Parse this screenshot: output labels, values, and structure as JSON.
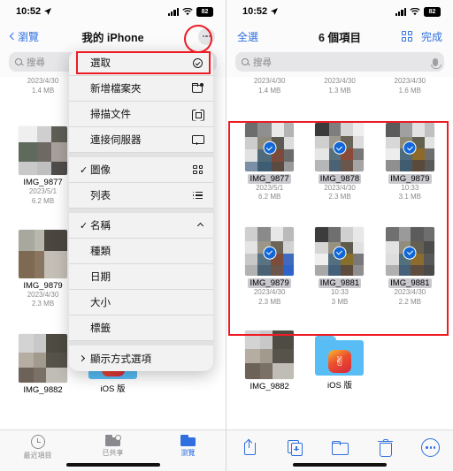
{
  "left": {
    "status": {
      "time": "10:52",
      "location_icon": "location-arrow",
      "signal_icon": "cellular-bars",
      "wifi_icon": "wifi",
      "battery": "82"
    },
    "nav": {
      "back_label": "瀏覽",
      "title": "我的 iPhone",
      "more_icon": "ellipsis-circle-icon"
    },
    "search": {
      "placeholder": "搜尋",
      "icon": "search-icon"
    },
    "menu": {
      "items": [
        {
          "label": "選取",
          "icon": "circle-check-icon",
          "checked": false,
          "highlighted": true
        },
        {
          "label": "新增檔案夾",
          "icon": "new-folder-icon",
          "checked": false
        },
        {
          "label": "掃描文件",
          "icon": "scan-document-icon",
          "checked": false
        },
        {
          "label": "連接伺服器",
          "icon": "server-icon",
          "checked": false
        },
        {
          "label": "圖像",
          "icon": "icon-view-icon",
          "checked": true
        },
        {
          "label": "列表",
          "icon": "list-view-icon",
          "checked": false
        },
        {
          "label": "名稱",
          "icon": "chevron-up-icon",
          "checked": true
        },
        {
          "label": "種類",
          "icon": "",
          "checked": false
        },
        {
          "label": "日期",
          "icon": "",
          "checked": false
        },
        {
          "label": "大小",
          "icon": "",
          "checked": false
        },
        {
          "label": "標籤",
          "icon": "",
          "checked": false
        },
        {
          "label": "顯示方式選項",
          "icon": "chevron-right-icon",
          "checked": false
        }
      ]
    },
    "files": [
      {
        "name": "",
        "date": "2023/4/30",
        "size": "1.4 MB",
        "type": "image",
        "partial": true
      },
      {
        "name": "IMG_9877",
        "date": "2023/5/1",
        "size": "6.2 MB",
        "type": "image"
      },
      {
        "name": "IMG_9879",
        "date": "2023/4/30",
        "size": "2.3 MB",
        "type": "image"
      },
      {
        "name": "IMG_9882",
        "date": "",
        "size": "",
        "type": "image"
      },
      {
        "name": "iOS 版",
        "date": "",
        "size": "",
        "type": "folder",
        "sub": ""
      }
    ],
    "tabs": [
      {
        "label": "最近項目",
        "icon": "clock-icon",
        "active": false
      },
      {
        "label": "已共享",
        "icon": "shared-folder-icon",
        "active": false
      },
      {
        "label": "瀏覽",
        "icon": "browse-folder-icon",
        "active": true
      }
    ]
  },
  "right": {
    "status": {
      "time": "10:52",
      "location_icon": "location-arrow",
      "signal_icon": "cellular-bars",
      "wifi_icon": "wifi",
      "battery": "82"
    },
    "nav": {
      "select_all_label": "全選",
      "title": "6 個項目",
      "grid_icon": "grid-view-icon",
      "done_label": "完成"
    },
    "search": {
      "placeholder": "搜尋",
      "icon": "search-icon",
      "mic_icon": "microphone-icon"
    },
    "top_partial_row": [
      {
        "date": "2023/4/30",
        "size": "1.4 MB"
      },
      {
        "date": "2023/4/30",
        "size": "1.3 MB"
      },
      {
        "date": "2023/4/30",
        "size": "1.6 MB"
      }
    ],
    "selected_files": [
      {
        "name": "IMG_9877",
        "date": "2023/5/1",
        "size": "6.2 MB",
        "selected": true
      },
      {
        "name": "IMG_9878",
        "date": "2023/4/30",
        "size": "2.3 MB",
        "selected": true
      },
      {
        "name": "IMG_9879",
        "date": "10:33",
        "size": "3.1 MB",
        "selected": true
      },
      {
        "name": "IMG_9879",
        "date": "2023/4/30",
        "size": "2.3 MB",
        "selected": true
      },
      {
        "name": "IMG_9881",
        "date": "10:33",
        "size": "3 MB",
        "selected": true
      },
      {
        "name": "IMG_9881",
        "date": "2023/4/30",
        "size": "2.2 MB",
        "selected": true
      }
    ],
    "bottom_files": [
      {
        "name": "IMG_9882",
        "date": "",
        "size": "",
        "type": "image"
      },
      {
        "name": "iOS 版",
        "date": "",
        "size": "",
        "type": "folder"
      }
    ],
    "actions": [
      {
        "icon": "share-icon",
        "label": "share"
      },
      {
        "icon": "duplicate-icon",
        "label": "duplicate"
      },
      {
        "icon": "move-to-folder-icon",
        "label": "move"
      },
      {
        "icon": "trash-icon",
        "label": "delete"
      },
      {
        "icon": "more-circle-icon",
        "label": "more"
      }
    ]
  },
  "annotations": {
    "accent_color": "#ee1b24",
    "highlight_menu_item": "選取",
    "highlight_more_button": "ellipsis-circle-icon",
    "highlight_selection_region": "selected-files-grid"
  }
}
